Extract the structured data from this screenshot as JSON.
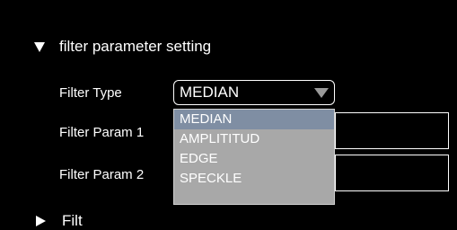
{
  "section": {
    "title": "filter parameter setting",
    "expand_icon": "triangle-down-icon"
  },
  "fields": {
    "filter_type_label": "Filter Type",
    "filter_param1_label": "Filter Param 1",
    "filter_param2_label": "Filter Param 2"
  },
  "filter_type_select": {
    "selected": "MEDIAN",
    "chevron_icon": "chevron-down-icon",
    "options": [
      "MEDIAN",
      "AMPLITITUD",
      "EDGE",
      "SPECKLE"
    ]
  },
  "next_section": {
    "title": "Filt",
    "collapse_icon": "triangle-right-icon"
  }
}
